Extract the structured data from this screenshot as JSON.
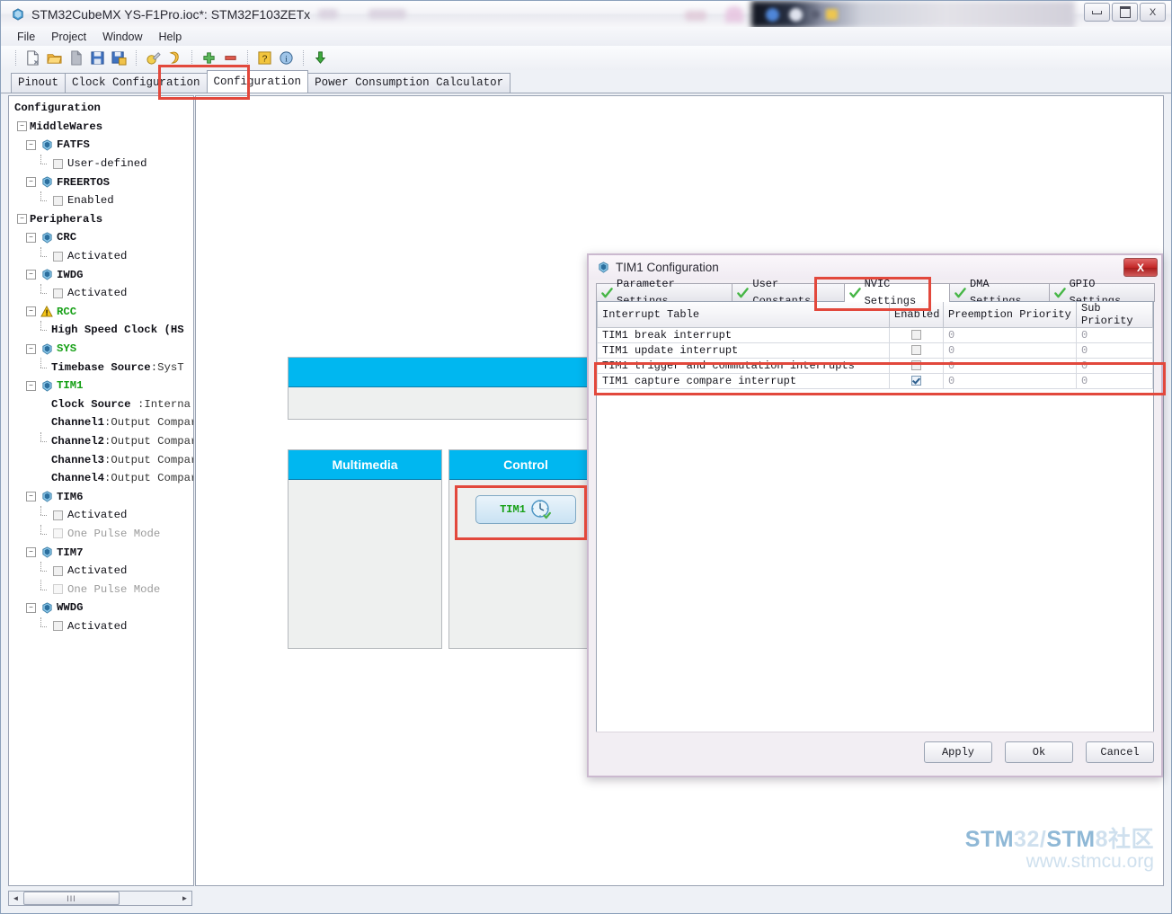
{
  "window": {
    "title": "STM32CubeMX YS-F1Pro.ioc*: STM32F103ZETx",
    "app_icon": "cube-icon",
    "minimize_label": "",
    "maximize_label": "",
    "close_label": "X"
  },
  "menu": {
    "items": [
      {
        "label": "File"
      },
      {
        "label": "Project"
      },
      {
        "label": "Window"
      },
      {
        "label": "Help"
      }
    ]
  },
  "toolbar": {
    "buttons": [
      {
        "name": "new-project-icon"
      },
      {
        "name": "open-project-icon"
      },
      {
        "name": "close-project-icon"
      },
      {
        "name": "save-project-icon"
      },
      {
        "name": "save-project-as-icon"
      },
      {
        "name": "generate-report-icon"
      },
      {
        "name": "generate-code-icon"
      },
      {
        "name": "zoom-in-icon"
      },
      {
        "name": "zoom-out-icon"
      },
      {
        "name": "help-icon"
      },
      {
        "name": "about-icon"
      },
      {
        "name": "update-icon"
      }
    ]
  },
  "main_tabs": {
    "items": [
      {
        "label": "Pinout",
        "active": false
      },
      {
        "label": "Clock Configuration",
        "active": false
      },
      {
        "label": "Configuration",
        "active": true
      },
      {
        "label": "Power Consumption Calculator",
        "active": false
      }
    ]
  },
  "sidebar": {
    "title": "Configuration",
    "nodes": [
      {
        "label": "Configuration",
        "type": "root",
        "indent": 0
      },
      {
        "label": "MiddleWares",
        "type": "group",
        "indent": 1
      },
      {
        "label": "FATFS",
        "type": "peripheral",
        "indent": 2,
        "icon": "shield-icon"
      },
      {
        "label": "User-defined",
        "type": "checkbox",
        "indent": 3,
        "checked": false
      },
      {
        "label": "FREERTOS",
        "type": "peripheral",
        "indent": 2,
        "icon": "shield-icon"
      },
      {
        "label": "Enabled",
        "type": "checkbox",
        "indent": 3,
        "checked": false
      },
      {
        "label": "Peripherals",
        "type": "group",
        "indent": 1
      },
      {
        "label": "CRC",
        "type": "peripheral",
        "indent": 2,
        "icon": "shield-icon"
      },
      {
        "label": "Activated",
        "type": "checkbox",
        "indent": 3,
        "checked": false
      },
      {
        "label": "IWDG",
        "type": "peripheral",
        "indent": 2,
        "icon": "shield-icon"
      },
      {
        "label": "Activated",
        "type": "checkbox",
        "indent": 3,
        "checked": false
      },
      {
        "label": "RCC",
        "type": "peripheral-green",
        "indent": 2,
        "icon": "warning-icon"
      },
      {
        "label": "High Speed Clock (HS",
        "type": "leaf-bold",
        "indent": 3
      },
      {
        "label": "SYS",
        "type": "peripheral-green",
        "indent": 2,
        "icon": "shield-icon"
      },
      {
        "label": "Timebase Source:SysT",
        "type": "leaf-mixed",
        "indent": 3,
        "bold_part": "Timebase Source",
        "rest": ":SysT"
      },
      {
        "label": "TIM1",
        "type": "peripheral-green",
        "indent": 2,
        "icon": "shield-icon"
      },
      {
        "label": "Clock Source :Interna",
        "type": "leaf-mixed",
        "indent": 3,
        "bold_part": "Clock Source ",
        "rest": ":Interna"
      },
      {
        "label": "Channel1:Output Compar",
        "type": "leaf-mixed",
        "indent": 3,
        "bold_part": "Channel1",
        "rest": ":Output Compar"
      },
      {
        "label": "Channel2:Output Compar",
        "type": "leaf-mixed",
        "indent": 3,
        "bold_part": "Channel2",
        "rest": ":Output Compar"
      },
      {
        "label": "Channel3:Output Compar",
        "type": "leaf-mixed",
        "indent": 3,
        "bold_part": "Channel3",
        "rest": ":Output Compar"
      },
      {
        "label": "Channel4:Output Compar",
        "type": "leaf-mixed",
        "indent": 3,
        "bold_part": "Channel4",
        "rest": ":Output Compar"
      },
      {
        "label": "TIM6",
        "type": "peripheral",
        "indent": 2,
        "icon": "shield-icon"
      },
      {
        "label": "Activated",
        "type": "checkbox",
        "indent": 3,
        "checked": false
      },
      {
        "label": "One Pulse Mode",
        "type": "checkbox-disabled",
        "indent": 3,
        "checked": false
      },
      {
        "label": "TIM7",
        "type": "peripheral",
        "indent": 2,
        "icon": "shield-icon"
      },
      {
        "label": "Activated",
        "type": "checkbox",
        "indent": 3,
        "checked": false
      },
      {
        "label": "One Pulse Mode",
        "type": "checkbox-disabled",
        "indent": 3,
        "checked": false
      },
      {
        "label": "WWDG",
        "type": "peripheral",
        "indent": 2,
        "icon": "shield-icon"
      },
      {
        "label": "Activated",
        "type": "checkbox",
        "indent": 3,
        "checked": false
      }
    ],
    "scrollbar": {
      "left_arrow": "◄",
      "right_arrow": "►",
      "grip": "III"
    }
  },
  "canvas": {
    "panels": [
      {
        "name": "hidden-top-panel",
        "title": ""
      },
      {
        "name": "multimedia-panel",
        "title": "Multimedia",
        "items": []
      },
      {
        "name": "control-panel",
        "title": "Control",
        "items": [
          {
            "label": "TIM1",
            "icon": "clock-icon",
            "status": "check-icon"
          }
        ]
      }
    ],
    "header_color": "#00b7f0"
  },
  "watermark": {
    "line1_a": "STM",
    "line1_b": "32/",
    "line1_c": "STM",
    "line1_d": "8社区",
    "line2": "www.stmcu.org"
  },
  "dialog": {
    "title": "TIM1 Configuration",
    "icon": "cube-icon",
    "close_label": "X",
    "tabs": [
      {
        "label": "Parameter Settings",
        "icon": "check-icon",
        "active": false
      },
      {
        "label": "User Constants",
        "icon": "check-icon",
        "active": false
      },
      {
        "label": "NVIC Settings",
        "icon": "check-icon",
        "active": true
      },
      {
        "label": "DMA Settings",
        "icon": "check-icon",
        "active": false
      },
      {
        "label": "GPIO Settings",
        "icon": "check-icon",
        "active": false
      }
    ],
    "table": {
      "columns": [
        "Interrupt Table",
        "Enabled",
        "Preemption Priority",
        "Sub Priority"
      ],
      "rows": [
        {
          "interrupt": "TIM1 break interrupt",
          "enabled": false,
          "preemption_priority": "0",
          "sub_priority": "0"
        },
        {
          "interrupt": "TIM1 update interrupt",
          "enabled": false,
          "preemption_priority": "0",
          "sub_priority": "0"
        },
        {
          "interrupt": "TIM1 trigger and commutation interrupts",
          "enabled": false,
          "preemption_priority": "0",
          "sub_priority": "0"
        },
        {
          "interrupt": "TIM1 capture compare interrupt",
          "enabled": true,
          "preemption_priority": "0",
          "sub_priority": "0"
        }
      ]
    },
    "buttons": [
      {
        "label": "Apply",
        "name": "apply-button"
      },
      {
        "label": "Ok",
        "name": "ok-button"
      },
      {
        "label": "Cancel",
        "name": "cancel-button"
      }
    ]
  }
}
